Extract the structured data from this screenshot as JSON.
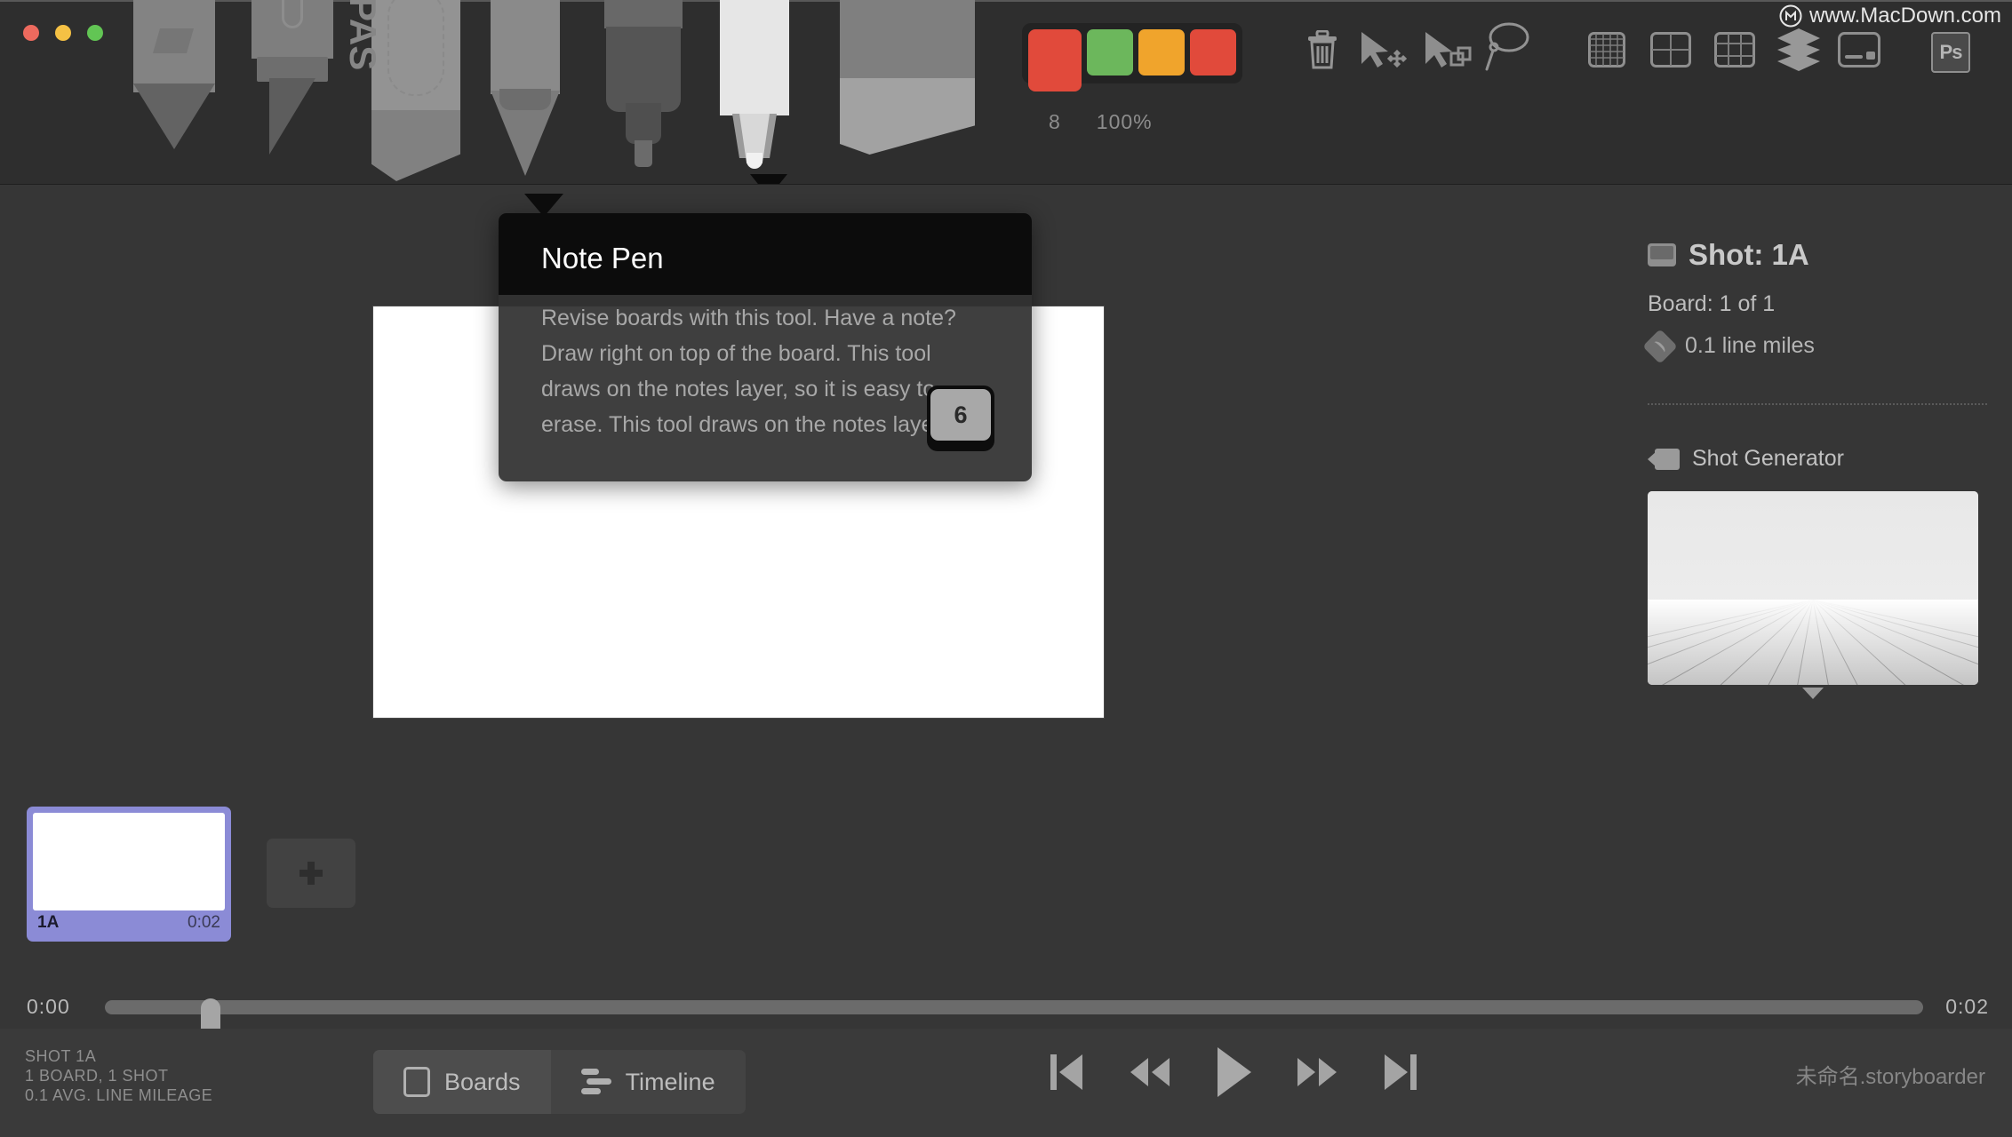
{
  "window": {
    "traffic_lights": [
      {
        "name": "close",
        "color": "#ed6a5e"
      },
      {
        "name": "minimize",
        "color": "#f5c144"
      },
      {
        "name": "maximize",
        "color": "#62c554"
      }
    ]
  },
  "watermark": {
    "text": "www.MacDown.com",
    "logo": "macdown-logo-icon"
  },
  "toolbar": {
    "tools": [
      {
        "name": "brush-tool",
        "label": "Brush"
      },
      {
        "name": "marker-tool",
        "label": "Marker"
      },
      {
        "name": "pastel-tool",
        "label": "Pastel"
      },
      {
        "name": "pencil-tool",
        "label": "Pencil"
      },
      {
        "name": "pen-tool",
        "label": "Pen"
      },
      {
        "name": "note-pen-tool",
        "label": "Note Pen"
      },
      {
        "name": "eraser-tool",
        "label": "Eraser"
      }
    ],
    "palette": {
      "current_color": "#e14a3b",
      "swatches": [
        "#e14a3b",
        "#6cb75c",
        "#f0a42c",
        "#e14a3b"
      ],
      "size_value": "8",
      "opacity_value": "100%"
    },
    "actions": [
      {
        "name": "trash-icon",
        "label": "Clear"
      },
      {
        "name": "move-cursor-icon",
        "label": "Move"
      },
      {
        "name": "scale-cursor-icon",
        "label": "Transform"
      },
      {
        "name": "lasso-icon",
        "label": "Lasso"
      }
    ],
    "views": [
      {
        "name": "grid-icon",
        "label": "Grid"
      },
      {
        "name": "center-guide-icon",
        "label": "Center"
      },
      {
        "name": "thirds-icon",
        "label": "Thirds"
      },
      {
        "name": "layers-icon",
        "label": "Layers"
      },
      {
        "name": "caption-icon",
        "label": "Captions"
      },
      {
        "name": "photoshop-icon",
        "label": "Ps"
      }
    ],
    "ps_label": "Ps"
  },
  "tooltip": {
    "title": "Note Pen",
    "description": "Revise boards with this tool. Have a note? Draw right on top of the board. This tool draws on the notes layer, so it is easy to erase. This tool draws on the notes layer.",
    "shortcut_key": "6"
  },
  "sidebar": {
    "shot_title": "Shot: 1A",
    "board_count": "Board: 1 of 1",
    "line_miles": "0.1 line miles",
    "generator_title": "Shot Generator"
  },
  "board_strip": {
    "thumbnails": [
      {
        "label": "1A",
        "duration": "0:02",
        "selected": true
      }
    ],
    "add_label": "+"
  },
  "timeline": {
    "start_time": "0:00",
    "end_time": "0:02",
    "playhead_position_pct": 0
  },
  "status": {
    "line1": "SHOT 1A",
    "line2": "1 BOARD, 1 SHOT",
    "line3": "0.1 AVG. LINE MILEAGE"
  },
  "view_toggle": {
    "boards_label": "Boards",
    "timeline_label": "Timeline",
    "active": "Boards"
  },
  "transport": [
    {
      "name": "skip-start-button",
      "label": "Skip to start"
    },
    {
      "name": "rewind-button",
      "label": "Rewind"
    },
    {
      "name": "play-button",
      "label": "Play"
    },
    {
      "name": "fast-forward-button",
      "label": "Fast forward"
    },
    {
      "name": "skip-end-button",
      "label": "Skip to end"
    }
  ],
  "filename": "未命名.storyboarder"
}
